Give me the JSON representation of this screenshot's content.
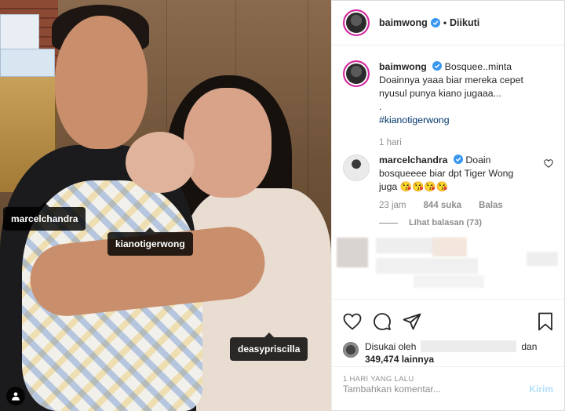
{
  "photo": {
    "tags": {
      "marcel": "marcelchandra",
      "kiano": "kianotigerwong",
      "deasy": "deasypriscilla"
    },
    "tagged_users_icon": "user-icon"
  },
  "header": {
    "username": "baimwong",
    "separator": "•",
    "follow_status": "Diikuti"
  },
  "caption": {
    "username": "baimwong",
    "text_line1": "Bosquee..minta",
    "text_line2": "Doainnya yaaa biar mereka cepet",
    "text_line3": "nyusul punya kiano jugaaa...",
    "text_line4": ".",
    "hashtag": "#kianotigerwong",
    "time": "1 hari"
  },
  "comment": {
    "username": "marcelchandra",
    "text_line1": "Doain",
    "text_line2": "bosqueeee biar dpt Tiger Wong",
    "text_line3": "juga",
    "emojis": [
      "😘",
      "😘",
      "😘",
      "😘"
    ],
    "time": "23 jam",
    "likes": "844 suka",
    "reply": "Balas",
    "view_replies": "Lihat balasan (73)"
  },
  "likes": {
    "prefix": "Disukai oleh",
    "and": "dan",
    "count": "349,474 lainnya"
  },
  "timestamp": "1 HARI YANG LALU",
  "add_comment": {
    "placeholder": "Tambahkan komentar...",
    "post_label": "Kirim"
  },
  "colors": {
    "verified": "#3897f0",
    "hashtag": "#003569",
    "muted": "#8e8e8e",
    "post_disabled": "#b2dffc"
  }
}
